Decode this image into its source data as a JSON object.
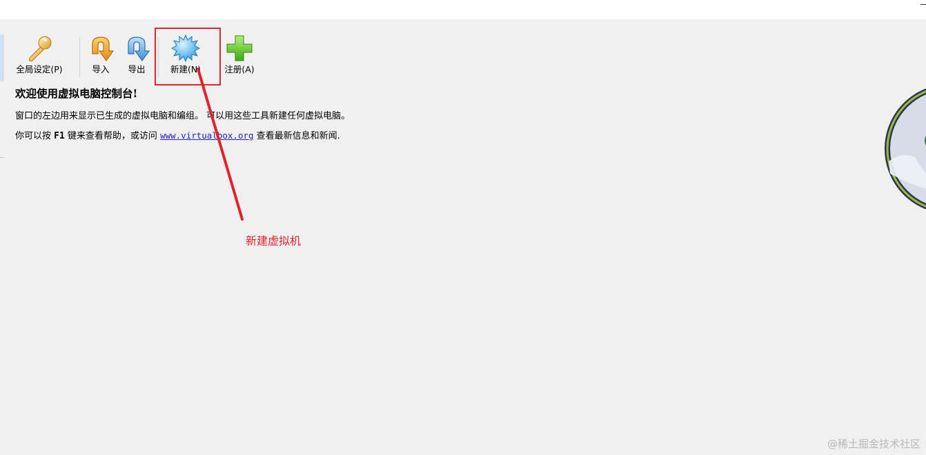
{
  "toolbar": {
    "buttons": [
      {
        "label": "全局设定(P)",
        "icon": "wrench-icon"
      },
      {
        "label": "导入",
        "icon": "import-arrow-icon"
      },
      {
        "label": "导出",
        "icon": "export-arrow-icon"
      },
      {
        "label": "新建(N)",
        "icon": "new-starburst-icon"
      },
      {
        "label": "注册(A)",
        "icon": "plus-icon"
      }
    ]
  },
  "welcome": {
    "title": "欢迎使用虚拟电脑控制台!",
    "line1": "窗口的左边用来显示已生成的虚拟电脑和编组。 可以用这些工具新建任何虚拟电脑。",
    "line2_prefix": "你可以按 ",
    "line2_key": "F1",
    "line2_mid": " 键来查看帮助，或访问 ",
    "line2_link": "www.virtualbox.org",
    "line2_suffix": " 查看最新信息和新闻."
  },
  "annotation": {
    "label": "新建虚拟机",
    "color": "#e0242d"
  },
  "watermark": "@稀土掘金技术社区"
}
